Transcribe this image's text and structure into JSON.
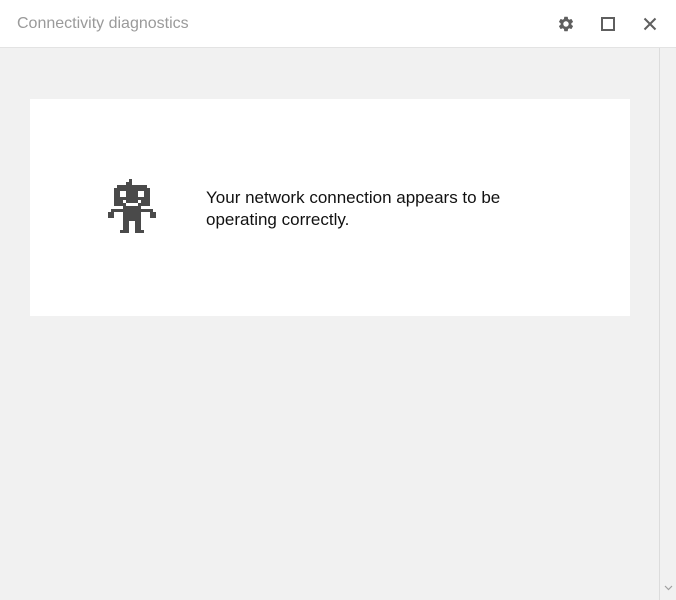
{
  "window": {
    "title": "Connectivity diagnostics",
    "controls": {
      "settings_icon": "gear-icon",
      "maximize_icon": "maximize-icon",
      "close_icon": "close-icon"
    }
  },
  "main": {
    "status_icon": "robot-icon",
    "status_message": "Your network connection appears to be operating correctly."
  },
  "colors": {
    "titlebar_bg": "#ffffff",
    "content_bg": "#f1f1f1",
    "card_bg": "#ffffff",
    "title_text": "#9a9a9a",
    "icon": "#5f5f5f",
    "robot": "#4a4a4a"
  }
}
